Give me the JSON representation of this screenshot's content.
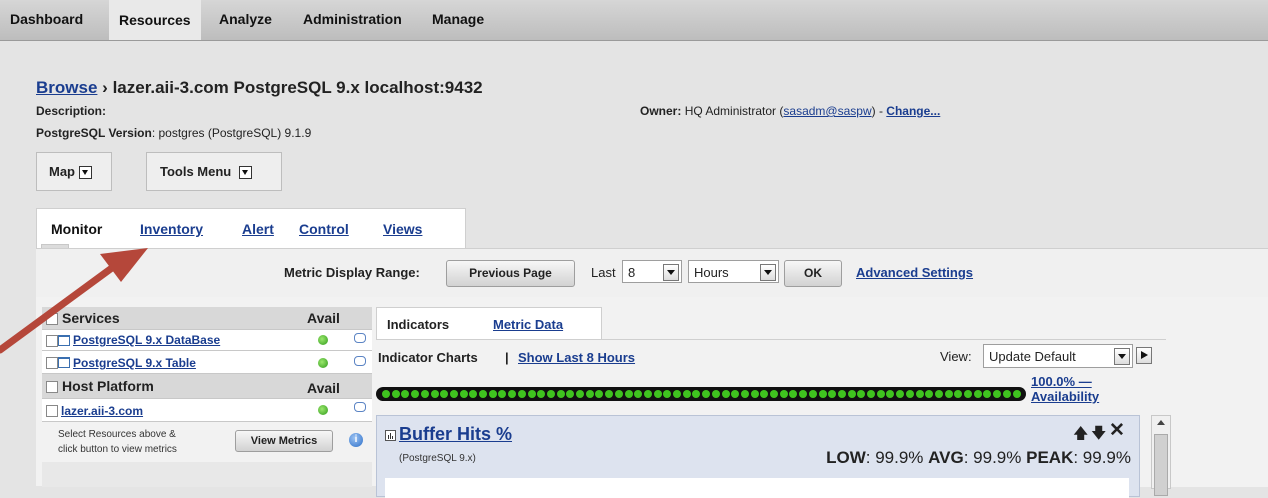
{
  "topnav": {
    "items": [
      "Dashboard",
      "Resources",
      "Analyze",
      "Administration",
      "Manage"
    ],
    "active": "Resources"
  },
  "breadcrumb": {
    "browse_link": "Browse",
    "separator": "›",
    "title": "lazer.aii-3.com PostgreSQL 9.x localhost:9432"
  },
  "details": {
    "description_label": "Description:",
    "version_label": "PostgreSQL Version",
    "version_value": ": postgres (PostgreSQL) 9.1.9",
    "owner_label": "Owner:",
    "owner_name": "HQ Administrator (",
    "owner_email": "sasadm@saspw",
    "owner_sep": ") - ",
    "change_link": "Change..."
  },
  "actions": {
    "map_label": "Map",
    "tools_label": "Tools Menu"
  },
  "tabs": [
    "Monitor",
    "Inventory",
    "Alert",
    "Control",
    "Views"
  ],
  "range": {
    "label": "Metric Display Range:",
    "previous_page": "Previous Page",
    "last_label": "Last",
    "last_value": "8",
    "unit_value": "Hours",
    "ok_label": "OK",
    "advanced_link": "Advanced Settings"
  },
  "left": {
    "services_header": "Services",
    "avail_header": "Avail",
    "services": [
      "PostgreSQL 9.x DataBase",
      "PostgreSQL 9.x Table"
    ],
    "host_header": "Host Platform",
    "host_avail_header": "Avail",
    "hosts": [
      "lazer.aii-3.com"
    ],
    "hint_line1": "Select Resources above &",
    "hint_line2": "click button to view metrics",
    "view_metrics": "View Metrics"
  },
  "right": {
    "subtabs": [
      "Indicators",
      "Metric Data"
    ],
    "indicator_title": "Indicator Charts",
    "indicator_sep": "|",
    "show_last": "Show Last 8 Hours",
    "view_label": "View:",
    "view_value": "Update Default",
    "availability_pct": "100.0% —",
    "availability_label": "Availability",
    "availability_value": 1.0
  },
  "chart": {
    "title": "Buffer Hits %",
    "subtitle": "(PostgreSQL 9.x)",
    "low_label": "LOW",
    "low_value": ": 99.9%",
    "avg_label": "AVG",
    "avg_value": ": 99.9%",
    "peak_label": "PEAK",
    "peak_value": ": 99.9%"
  },
  "colors": {
    "annotation_arrow": "#b5473a",
    "link": "#1a3d8f",
    "avail_green": "#3fc41f"
  }
}
